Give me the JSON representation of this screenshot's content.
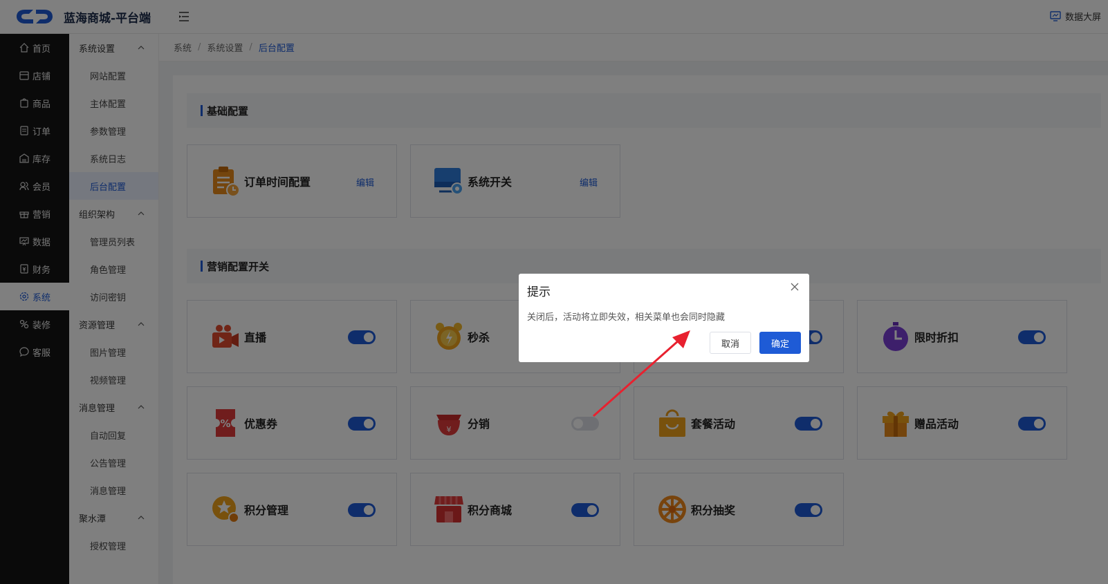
{
  "app": {
    "title": "蓝海商城-平台端",
    "data_screen": "数据大屏"
  },
  "nav_primary": [
    {
      "label": "首页",
      "icon": "home-icon"
    },
    {
      "label": "店铺",
      "icon": "store-icon"
    },
    {
      "label": "商品",
      "icon": "goods-icon"
    },
    {
      "label": "订单",
      "icon": "order-icon"
    },
    {
      "label": "库存",
      "icon": "warehouse-icon"
    },
    {
      "label": "会员",
      "icon": "member-icon"
    },
    {
      "label": "营销",
      "icon": "gift-icon"
    },
    {
      "label": "数据",
      "icon": "data-icon"
    },
    {
      "label": "财务",
      "icon": "finance-icon"
    },
    {
      "label": "系统",
      "icon": "gear-icon",
      "active": true
    },
    {
      "label": "装修",
      "icon": "decorate-icon"
    },
    {
      "label": "客服",
      "icon": "chat-icon"
    }
  ],
  "nav_secondary": {
    "groups": [
      {
        "label": "系统设置",
        "items": [
          "网站配置",
          "主体配置",
          "参数管理",
          "系统日志",
          "后台配置"
        ]
      },
      {
        "label": "组织架构",
        "items": [
          "管理员列表",
          "角色管理",
          "访问密钥"
        ]
      },
      {
        "label": "资源管理",
        "items": [
          "图片管理",
          "视频管理"
        ]
      },
      {
        "label": "消息管理",
        "items": [
          "自动回复",
          "公告管理",
          "消息管理"
        ]
      },
      {
        "label": "聚水潭",
        "items": [
          "授权管理"
        ]
      }
    ],
    "active_item": "后台配置"
  },
  "breadcrumb": [
    "系统",
    "系统设置",
    "后台配置"
  ],
  "sections": {
    "basic": {
      "title": "基础配置",
      "cards": [
        {
          "title": "订单时间配置",
          "action": "编辑",
          "icon": "clipboard-clock-icon"
        },
        {
          "title": "系统开关",
          "action": "编辑",
          "icon": "monitor-gear-icon"
        }
      ]
    },
    "marketing": {
      "title": "营销配置开关",
      "cards": [
        {
          "title": "直播",
          "on": true,
          "icon": "live-camera-icon"
        },
        {
          "title": "秒杀",
          "on": true,
          "icon": "alarm-clock-icon"
        },
        {
          "title": "",
          "on": true,
          "icon": ""
        },
        {
          "title": "限时折扣",
          "on": true,
          "icon": "stopwatch-icon"
        },
        {
          "title": "优惠券",
          "on": true,
          "icon": "coupon-icon"
        },
        {
          "title": "分销",
          "on": false,
          "icon": "money-bag-icon"
        },
        {
          "title": "套餐活动",
          "on": true,
          "icon": "shopping-bag-icon"
        },
        {
          "title": "赠品活动",
          "on": true,
          "icon": "gift-box-icon"
        },
        {
          "title": "积分管理",
          "on": true,
          "icon": "points-star-icon"
        },
        {
          "title": "积分商城",
          "on": true,
          "icon": "shop-awning-icon"
        },
        {
          "title": "积分抽奖",
          "on": true,
          "icon": "lottery-wheel-icon"
        }
      ]
    }
  },
  "dialog": {
    "title": "提示",
    "message": "关闭后，活动将立即失效，相关菜单也会同时隐藏",
    "cancel": "取消",
    "confirm": "确定"
  },
  "colors": {
    "primary": "#1e5bd6",
    "sidebar": "#141414",
    "annotation": "#e8212f"
  }
}
